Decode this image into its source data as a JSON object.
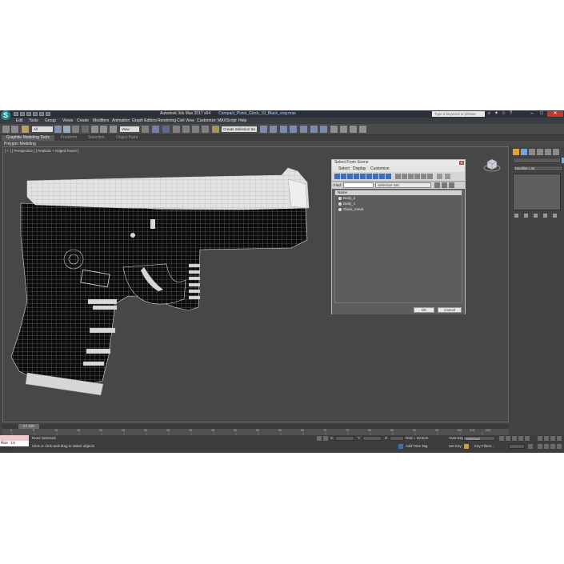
{
  "app": {
    "logo_glyph": "S",
    "title": "Autodesk 3ds Max  2017 x64",
    "file": "Compact_Pistol_Glock_19_Black_vray.max",
    "search_placeholder": "Type a keyword or phrase"
  },
  "menu": [
    "Edit",
    "Tools",
    "Group",
    "Views",
    "Create",
    "Modifiers",
    "Animation",
    "Graph Editors",
    "Rendering",
    "Civil View",
    "Customize",
    "MAXScript",
    "Help"
  ],
  "toolbar": {
    "filter_dropdown": "All",
    "view_dropdown": "View",
    "selection_set_dropdown": "Create Selection Se"
  },
  "ribbon": {
    "tabs": [
      "Graphite Modeling Tools",
      "Freeform",
      "Selection",
      "Object Paint"
    ],
    "active_tab": "Graphite Modeling Tools",
    "sub_label": "Polygon Modeling"
  },
  "viewport": {
    "label": "[ + ] [ Perspective ] [ Realistic + Edged Faces ]"
  },
  "select_dialog": {
    "title": "Select From Scene",
    "menus": [
      "Select",
      "Display",
      "Customize"
    ],
    "find_label": "Find:",
    "selection_set_label": "Selection Set:",
    "column_header": "Name",
    "items": [
      "Body_2",
      "Body_1",
      "Glock_metal"
    ],
    "ok_label": "OK",
    "cancel_label": "Cancel"
  },
  "command_panel": {
    "modifier_list_label": "Modifier List"
  },
  "timeline": {
    "frame_display": "0 / 100",
    "ticks": [
      "0",
      "5",
      "10",
      "15",
      "20",
      "25",
      "30",
      "35",
      "40",
      "45",
      "50",
      "55",
      "60",
      "65",
      "70",
      "75",
      "80",
      "85",
      "90",
      "95",
      "100"
    ],
    "ticks_right": [
      "210",
      "220"
    ]
  },
  "status": {
    "maxscript_text": "Max to Physc",
    "selection_text": "None Selected",
    "prompt_text": "Click or click-and-drag to select objects",
    "x_label": "X:",
    "y_label": "Y:",
    "z_label": "Z:",
    "grid_text": "Grid = 10,0cm",
    "add_time_tag": "Add Time Tag",
    "auto_key": "Auto Key",
    "auto_key_dropdown": "Selected",
    "set_key": "Set Key",
    "key_filters": "Key Filters..."
  },
  "colors": {
    "logo_teal": "#1d8a8e",
    "maxscript_pink": "#f0c8cf",
    "object_color": "#7ab0d8"
  }
}
